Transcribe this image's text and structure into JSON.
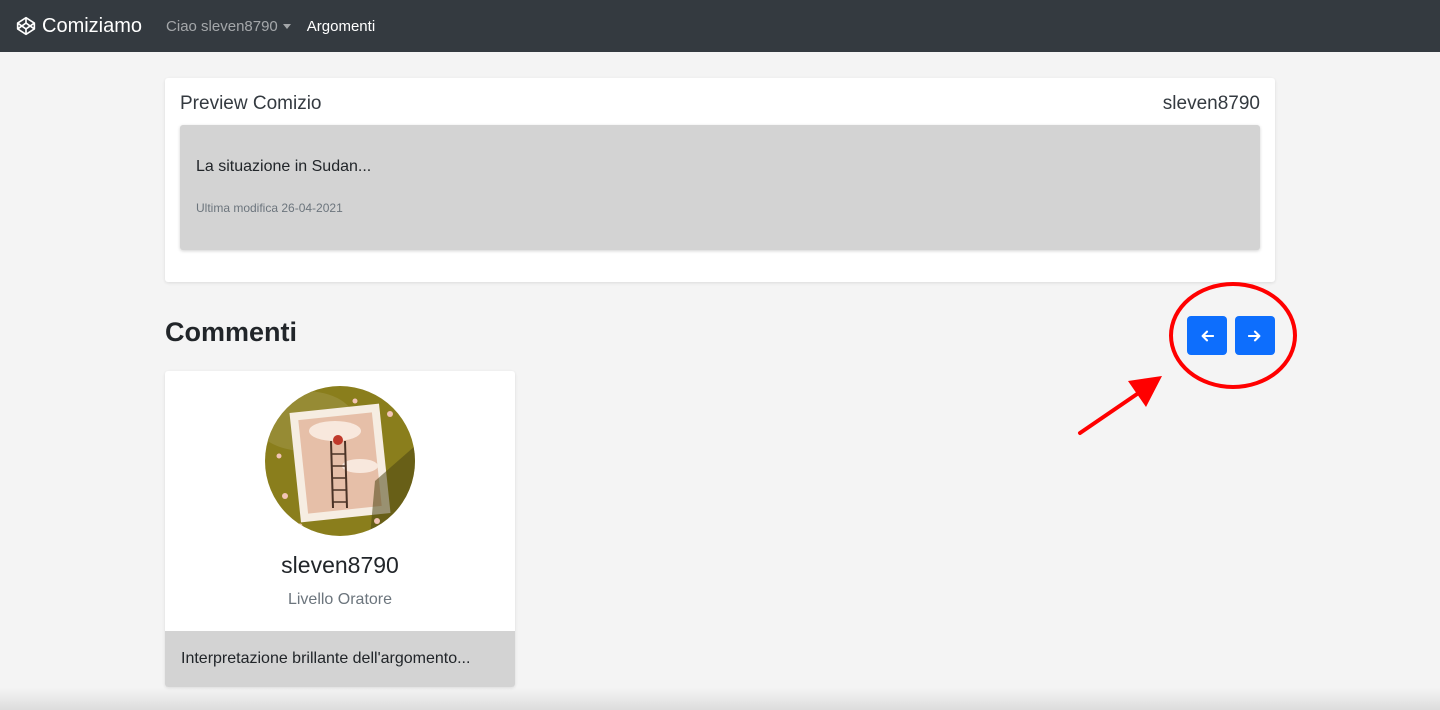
{
  "navbar": {
    "brand": "Comiziamo",
    "brand_icon": "codepen-cube-icon",
    "user_menu": "Ciao sleven8790",
    "link": "Argomenti"
  },
  "preview": {
    "title": "Preview Comizio",
    "author": "sleven8790",
    "text": "La situazione in Sudan...",
    "date": "Ultima modifica 26-04-2021"
  },
  "comments": {
    "heading": "Commenti",
    "prev_icon": "arrow-left-icon",
    "next_icon": "arrow-right-icon",
    "items": [
      {
        "avatar": "avatar-ladder-illustration",
        "username": "sleven8790",
        "level": "Livello Oratore",
        "text": "Interpretazione brillante dell'argomento..."
      }
    ]
  },
  "colors": {
    "navbar": "#343a40",
    "primary": "#0d6efd",
    "annotation": "#ff0000",
    "card_gray": "#d3d3d3",
    "page_bg": "#f4f4f4"
  }
}
